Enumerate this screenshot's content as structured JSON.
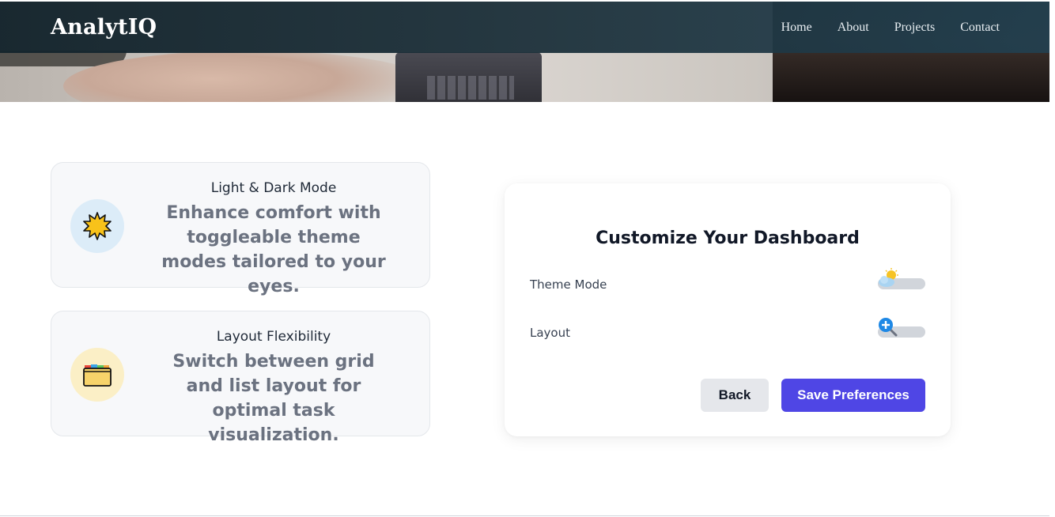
{
  "brand": {
    "name": "AnalytIQ"
  },
  "nav": {
    "items": [
      {
        "label": "Home"
      },
      {
        "label": "About"
      },
      {
        "label": "Projects"
      },
      {
        "label": "Contact"
      }
    ]
  },
  "features": [
    {
      "icon": "sun-icon",
      "title": "Light & Dark Mode",
      "description": "Enhance comfort with toggleable theme modes tailored to your eyes."
    },
    {
      "icon": "folder-icon",
      "title": "Layout Flexibility",
      "description": "Switch between grid and list layout for optimal task visualization."
    }
  ],
  "customize": {
    "title": "Customize Your Dashboard",
    "settings": [
      {
        "label": "Theme Mode",
        "icon": "sun-cloud-icon",
        "enabled": false
      },
      {
        "label": "Layout",
        "icon": "zoom-in-icon",
        "enabled": false
      }
    ],
    "back_label": "Back",
    "save_label": "Save Preferences"
  },
  "colors": {
    "primary": "#4f46e5",
    "navbar": "#1c3a48",
    "muted_text": "#6b7280"
  }
}
